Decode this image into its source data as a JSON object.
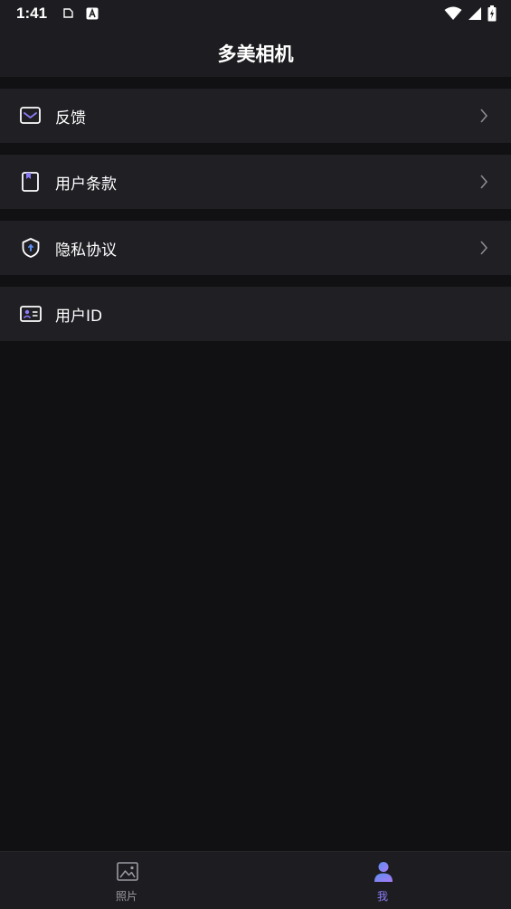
{
  "status_bar": {
    "time": "1:41"
  },
  "header": {
    "title": "多美相机"
  },
  "menu": {
    "items": [
      {
        "label": "反馈",
        "icon": "mail-icon"
      },
      {
        "label": "用户条款",
        "icon": "bookmark-book-icon"
      },
      {
        "label": "隐私协议",
        "icon": "shield-icon"
      },
      {
        "label": "用户ID",
        "icon": "id-card-icon"
      }
    ]
  },
  "bottom_nav": {
    "tabs": [
      {
        "label": "照片",
        "icon": "image-icon",
        "active": false
      },
      {
        "label": "我",
        "icon": "person-icon",
        "active": true
      }
    ]
  },
  "colors": {
    "accent": "#8b7cf6",
    "accent_blue": "#5b8def",
    "inactive": "#9a9aa2"
  }
}
